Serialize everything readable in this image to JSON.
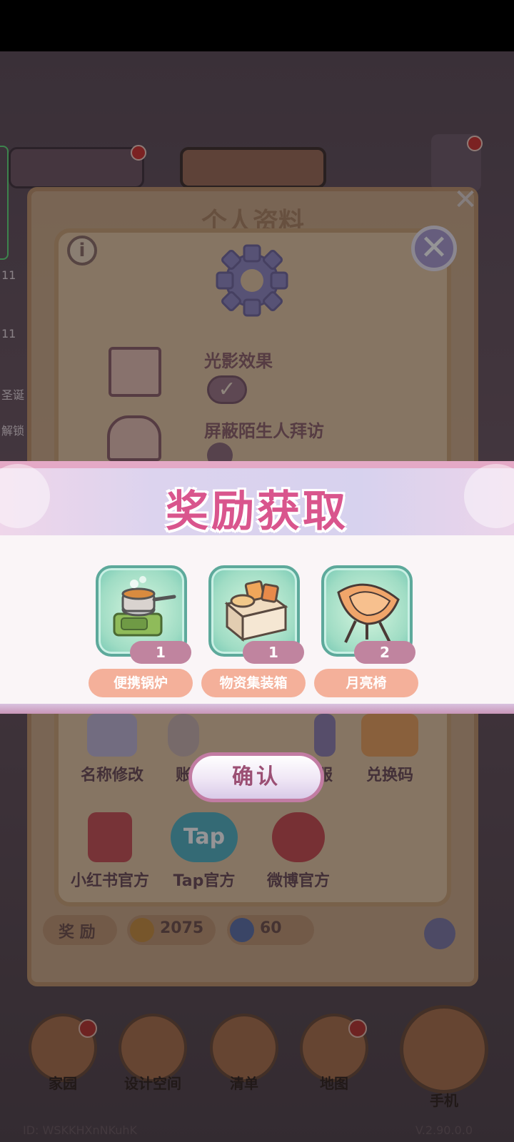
{
  "profile": {
    "title": "个人资料",
    "settings": {
      "light_shadow_label": "光影效果",
      "block_visitors_label": "屏蔽陌生人拜访"
    },
    "menu": [
      "名称修改",
      "账",
      "服",
      "兑换码",
      "小红书官方",
      "Tap官方",
      "微博官方"
    ],
    "tap_logo": "Tap",
    "rewards_tab": "奖 励",
    "currency_gold": "2075",
    "currency_blue": "60"
  },
  "left_labels": [
    "11",
    "11",
    "圣诞",
    "解锁"
  ],
  "reward_popup": {
    "title": "奖励获取",
    "items": [
      {
        "name": "便携锅炉",
        "qty": "1",
        "icon": "portable-stove-icon"
      },
      {
        "name": "物资集装箱",
        "qty": "1",
        "icon": "supply-crate-icon"
      },
      {
        "name": "月亮椅",
        "qty": "2",
        "icon": "moon-chair-icon"
      }
    ],
    "confirm_label": "确认"
  },
  "nav": {
    "home": "家园",
    "design": "设计空间",
    "list": "清单",
    "map": "地图",
    "phone": "手机"
  },
  "footer": {
    "id_text": "ID: WSKKHXnNKuhK",
    "version": "V.2.90.0.0"
  },
  "colors": {
    "banner_title": "#d9558d",
    "reward_card": "#9fdcc4",
    "reward_name_bg": "#f4b09a",
    "qty_bg": "#c0849f"
  }
}
